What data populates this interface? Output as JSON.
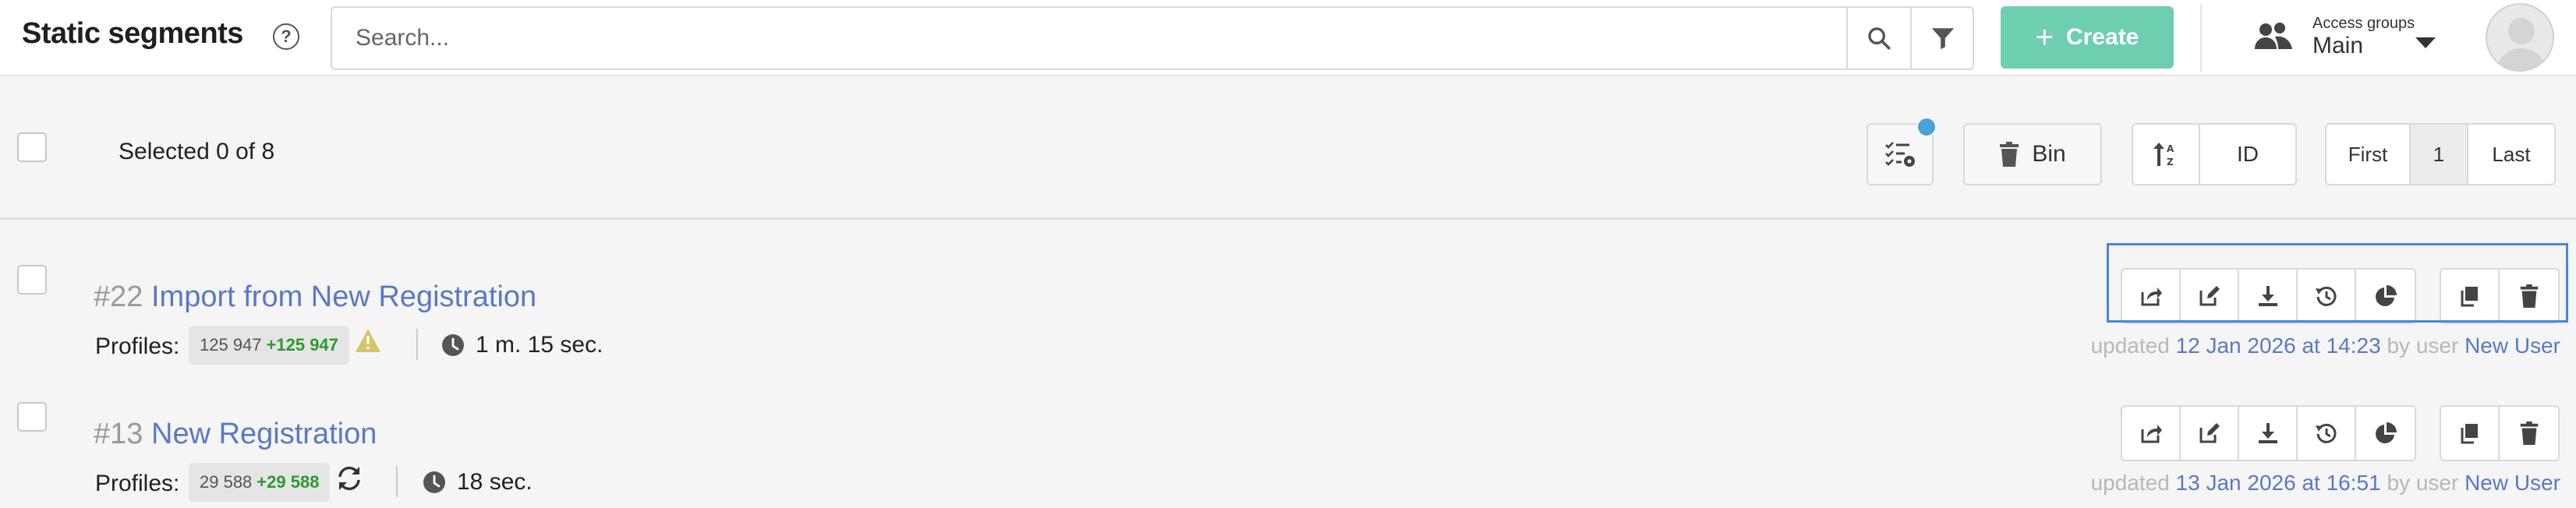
{
  "header": {
    "title": "Static segments",
    "help_glyph": "?",
    "search_placeholder": "Search...",
    "create_label": "Create",
    "access_groups_label": "Access groups",
    "access_group_value": "Main"
  },
  "toolbar": {
    "selected_text": "Selected 0 of 8",
    "bin_label": "Bin",
    "sort_field": "ID",
    "pagination": {
      "first": "First",
      "page": "1",
      "last": "Last"
    }
  },
  "rows": [
    {
      "id": "#22",
      "name": "Import from New Registration",
      "profiles_label": "Profiles:",
      "count": "125 947",
      "delta": "+125 947",
      "status_icon": "warning-icon",
      "duration": "1 m. 15 sec.",
      "updated_prefix": "updated",
      "updated_date": "12 Jan 2026 at 14:23",
      "updated_by": "by user",
      "user": "New User"
    },
    {
      "id": "#13",
      "name": "New Registration",
      "profiles_label": "Profiles:",
      "count": "29 588",
      "delta": "+29 588",
      "status_icon": "refresh-icon",
      "duration": "18 sec.",
      "updated_prefix": "updated",
      "updated_date": "13 Jan 2026 at 16:51",
      "updated_by": "by user",
      "user": "New User"
    }
  ],
  "colors": {
    "accent": "#6dcfb0",
    "link": "#5a79c4",
    "badge_delta": "#2c9a2c",
    "notify_dot": "#4aa3d8",
    "focus": "#4a84e0"
  }
}
